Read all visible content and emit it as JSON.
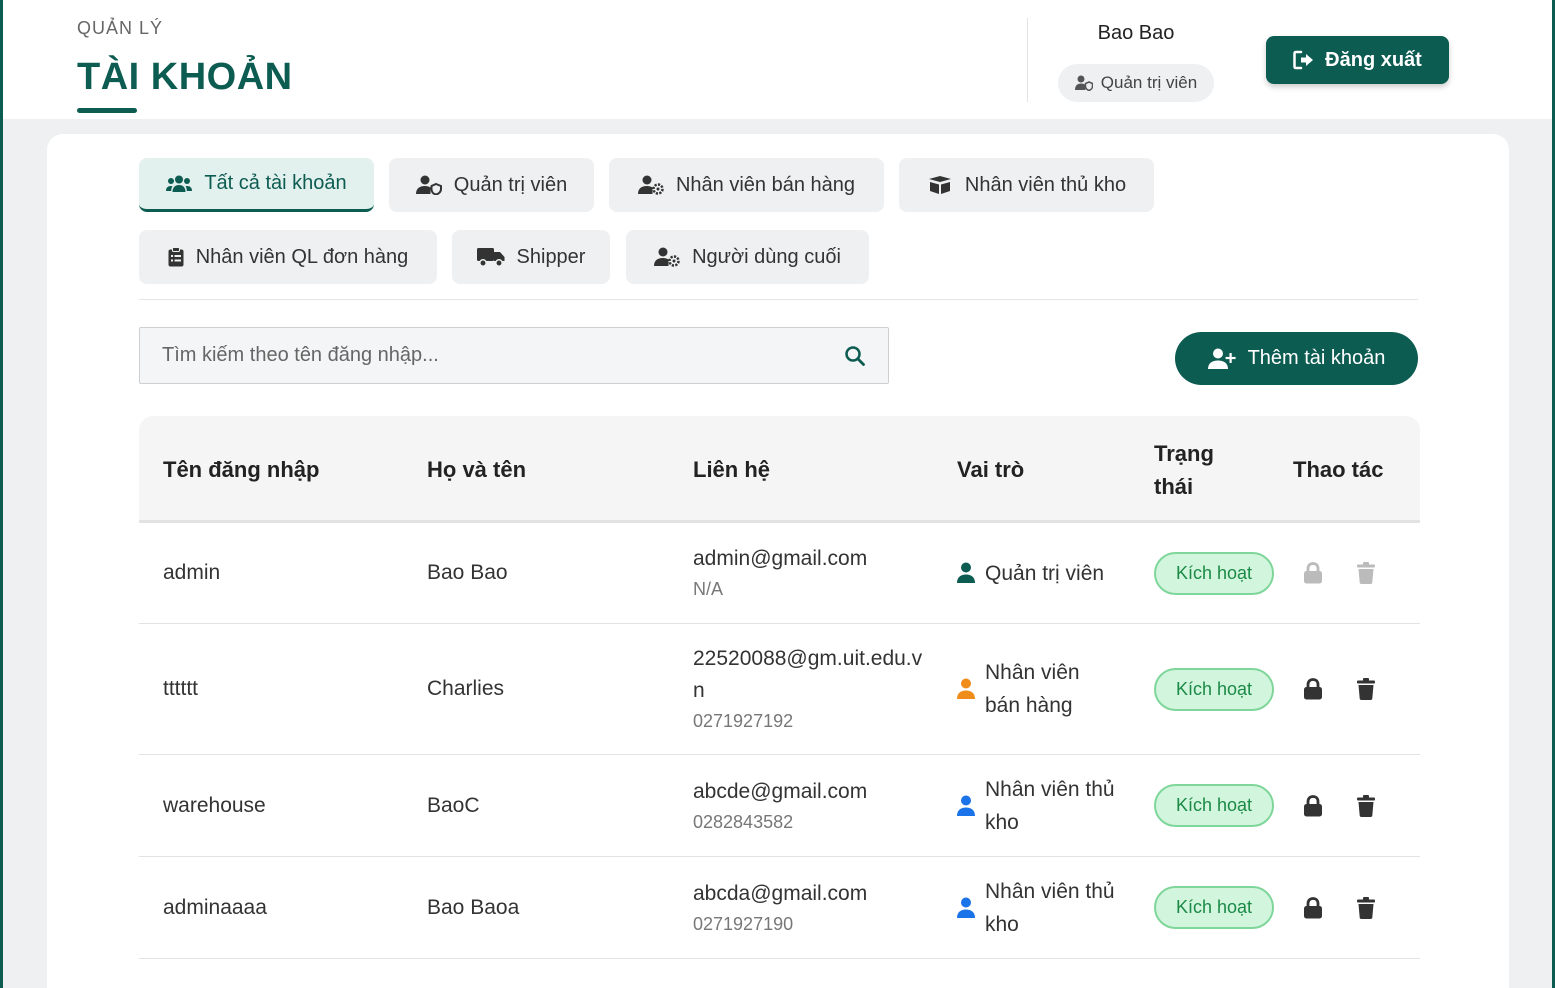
{
  "header": {
    "eyebrow": "QUẢN LÝ",
    "title": "TÀI KHOẢN",
    "user_name": "Bao Bao",
    "user_role": "Quản trị viên",
    "logout_label": "Đăng xuất"
  },
  "tabs": [
    {
      "label": "Tất cả tài khoản",
      "icon": "users-icon",
      "active": true
    },
    {
      "label": "Quản trị viên",
      "icon": "user-shield-icon"
    },
    {
      "label": "Nhân viên bán hàng",
      "icon": "user-gear-icon"
    },
    {
      "label": "Nhân viên thủ kho",
      "icon": "box-icon"
    },
    {
      "label": "Nhân viên QL đơn hàng",
      "icon": "clipboard-icon"
    },
    {
      "label": "Shipper",
      "icon": "truck-icon"
    },
    {
      "label": "Người dùng cuối",
      "icon": "user-gear-icon"
    }
  ],
  "search": {
    "placeholder": "Tìm kiếm theo tên đăng nhập...",
    "value": ""
  },
  "add_button_label": "Thêm tài khoản",
  "table": {
    "headers": {
      "username": "Tên đăng nhập",
      "fullname": "Họ và tên",
      "contact": "Liên hệ",
      "role": "Vai trò",
      "status": "Trạng thái",
      "actions": "Thao tác"
    },
    "rows": [
      {
        "username": "admin",
        "fullname": "Bao Bao",
        "email": "admin@gmail.com",
        "phone": "N/A",
        "role": "Quản trị viên",
        "role_color": "#0d5c52",
        "status": "Kích hoạt"
      },
      {
        "username": "tttttt",
        "fullname": "Charlies",
        "email": "22520088@gm.uit.edu.vn",
        "phone": "0271927192",
        "role": "Nhân viên bán hàng",
        "role_color": "#f08c1a",
        "status": "Kích hoạt"
      },
      {
        "username": "warehouse",
        "fullname": "BaoC",
        "email": "abcde@gmail.com",
        "phone": "0282843582",
        "role": "Nhân viên thủ kho",
        "role_color": "#1a73e8",
        "status": "Kích hoạt"
      },
      {
        "username": "adminaaaa",
        "fullname": "Bao Baoa",
        "email": "abcda@gmail.com",
        "phone": "0271927190",
        "role": "Nhân viên thủ kho",
        "role_color": "#1a73e8",
        "status": "Kích hoạt"
      }
    ]
  },
  "colors": {
    "primary": "#0d5c52",
    "status_bg": "#d2f5dd",
    "status_text": "#1a8a46"
  }
}
